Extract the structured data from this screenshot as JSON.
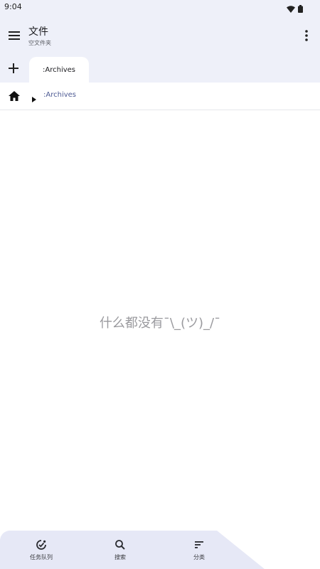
{
  "status_bar": {
    "time": "9:04",
    "icons": [
      "wifi-icon",
      "battery-icon"
    ]
  },
  "app_bar": {
    "title": "文件",
    "subtitle": "空文件夹",
    "menu_icon": "hamburger-menu-icon",
    "more_icon": "more-vertical-icon"
  },
  "tabs": {
    "add_icon": "plus-icon",
    "items": [
      {
        "label": ":Archives"
      }
    ]
  },
  "breadcrumb": {
    "home_icon": "home-icon",
    "arrow_icon": "play-arrow-icon",
    "path": ":Archives"
  },
  "empty_state": {
    "message": "什么都没有¯\\_(ツ)_/¯"
  },
  "bottom_nav": {
    "items": [
      {
        "label": "任务队列",
        "icon": "task-queue-icon"
      },
      {
        "label": "搜索",
        "icon": "search-icon"
      },
      {
        "label": "分类",
        "icon": "sort-icon"
      }
    ]
  },
  "colors": {
    "top_background": "#eef0f9",
    "accent": "#4d5a93",
    "bottom_bar": "#e6e8f6"
  }
}
